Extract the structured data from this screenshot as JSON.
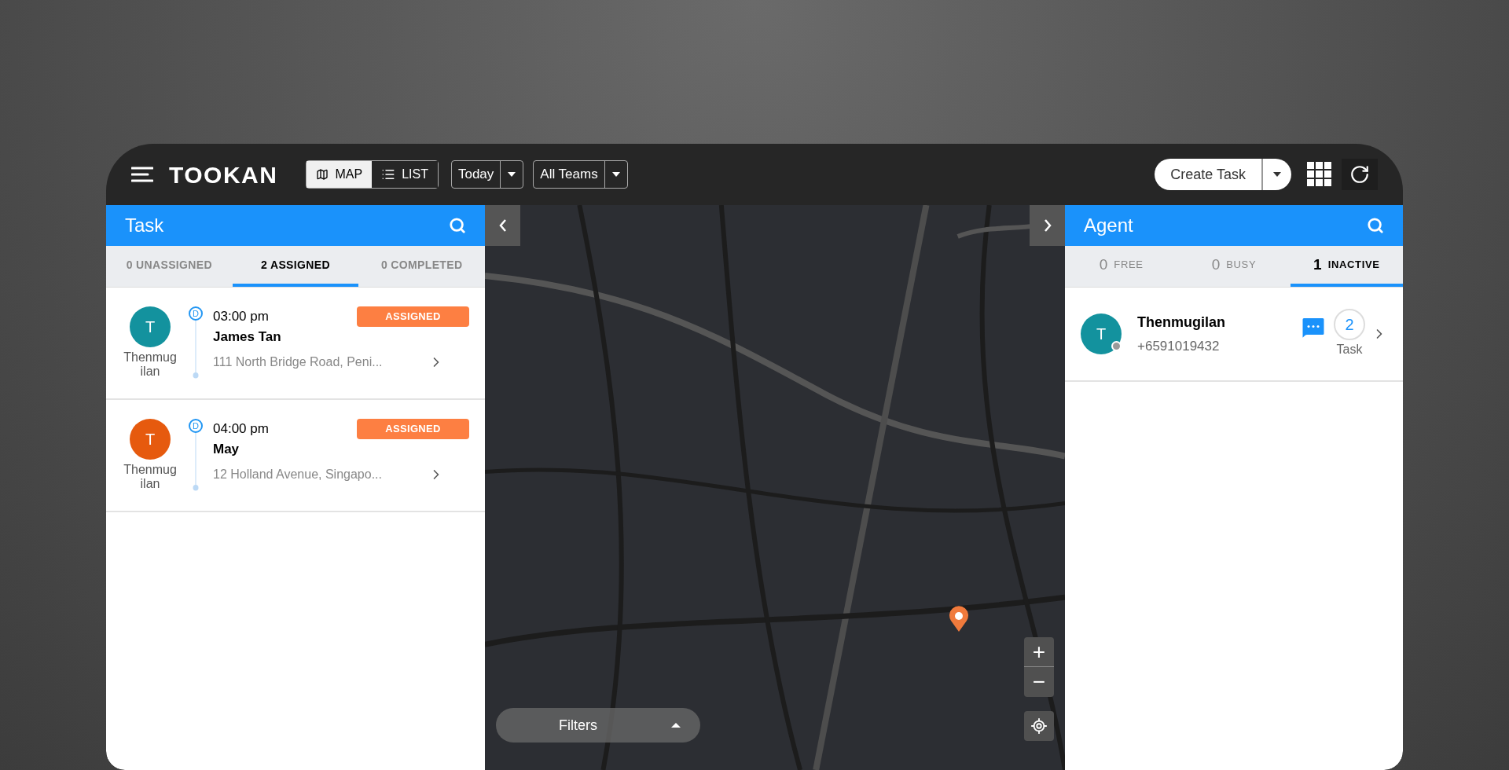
{
  "header": {
    "logo": "TOOKAN",
    "view_toggle": [
      {
        "label": "MAP",
        "selected": true
      },
      {
        "label": "LIST",
        "selected": false
      }
    ],
    "date_filter": "Today",
    "team_filter": "All Teams",
    "create_button": "Create Task"
  },
  "task_panel": {
    "title": "Task",
    "tabs": [
      {
        "label": "0 UNASSIGNED",
        "selected": false
      },
      {
        "label": "2 ASSIGNED",
        "selected": true
      },
      {
        "label": "0 COMPLETED",
        "selected": false
      }
    ],
    "tasks": [
      {
        "avatar": "T",
        "color": "#13929e",
        "agent": "Thenmug ilan",
        "marker": "D",
        "time": "03:00 pm",
        "customer": "James Tan",
        "address": "111 North Bridge Road, Peni...",
        "status": "ASSIGNED"
      },
      {
        "avatar": "T",
        "color": "#e65a0e",
        "agent": "Thenmug ilan",
        "marker": "D",
        "time": "04:00 pm",
        "customer": "May",
        "address": "12 Holland Avenue, Singapo...",
        "status": "ASSIGNED"
      }
    ]
  },
  "map": {
    "filters": "Filters",
    "zoom_in": "+",
    "zoom_out": "−"
  },
  "agent_panel": {
    "title": "Agent",
    "tabs": [
      {
        "count": "0",
        "label": "FREE",
        "selected": false
      },
      {
        "count": "0",
        "label": "BUSY",
        "selected": false
      },
      {
        "count": "1",
        "label": "INACTIVE",
        "selected": true
      }
    ],
    "agents": [
      {
        "avatar": "T",
        "color": "#13929e",
        "name": "Thenmugilan",
        "phone": "+6591019432",
        "task_count": "2",
        "task_label": "Task",
        "online": false
      }
    ]
  }
}
